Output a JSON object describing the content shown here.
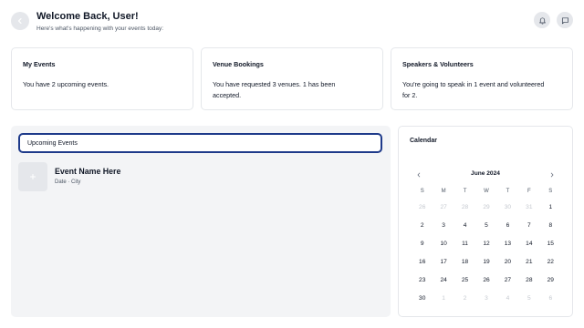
{
  "header": {
    "title": "Welcome Back, User!",
    "subtitle": "Here's what's happening with your events today:",
    "back_icon": "chevron-left-icon",
    "actions": [
      "bell-icon",
      "chat-icon"
    ]
  },
  "cards": [
    {
      "title": "My Events",
      "body": "You have 2 upcoming events."
    },
    {
      "title": "Venue Bookings",
      "body": "You have requested 3 venues. 1 has been accepted."
    },
    {
      "title": "Speakers & Volunteers",
      "body": "You're going to speak in 1 event and volunteered for 2."
    }
  ],
  "events": {
    "tab_label": "Upcoming Events",
    "items": [
      {
        "name": "Event Name Here",
        "meta": "Date · City"
      }
    ]
  },
  "calendar": {
    "title": "Calendar",
    "month": "June 2024",
    "weekdays": [
      "S",
      "M",
      "T",
      "W",
      "T",
      "F",
      "S"
    ],
    "weeks": [
      [
        "26",
        "27",
        "28",
        "29",
        "30",
        "31",
        "1"
      ],
      [
        "2",
        "3",
        "4",
        "5",
        "6",
        "7",
        "8"
      ],
      [
        "9",
        "10",
        "11",
        "12",
        "13",
        "14",
        "15"
      ],
      [
        "16",
        "17",
        "18",
        "19",
        "20",
        "21",
        "22"
      ],
      [
        "23",
        "24",
        "25",
        "26",
        "27",
        "28",
        "29"
      ],
      [
        "30",
        "1",
        "2",
        "3",
        "4",
        "5",
        "6"
      ]
    ],
    "muted_cells": [
      [
        0,
        0
      ],
      [
        0,
        1
      ],
      [
        0,
        2
      ],
      [
        0,
        3
      ],
      [
        0,
        4
      ],
      [
        0,
        5
      ],
      [
        5,
        1
      ],
      [
        5,
        2
      ],
      [
        5,
        3
      ],
      [
        5,
        4
      ],
      [
        5,
        5
      ],
      [
        5,
        6
      ]
    ]
  },
  "colors": {
    "accent": "#1e3a8a",
    "panel": "#f3f4f6",
    "border": "#e5e7eb",
    "muted": "#c4c8cf"
  }
}
